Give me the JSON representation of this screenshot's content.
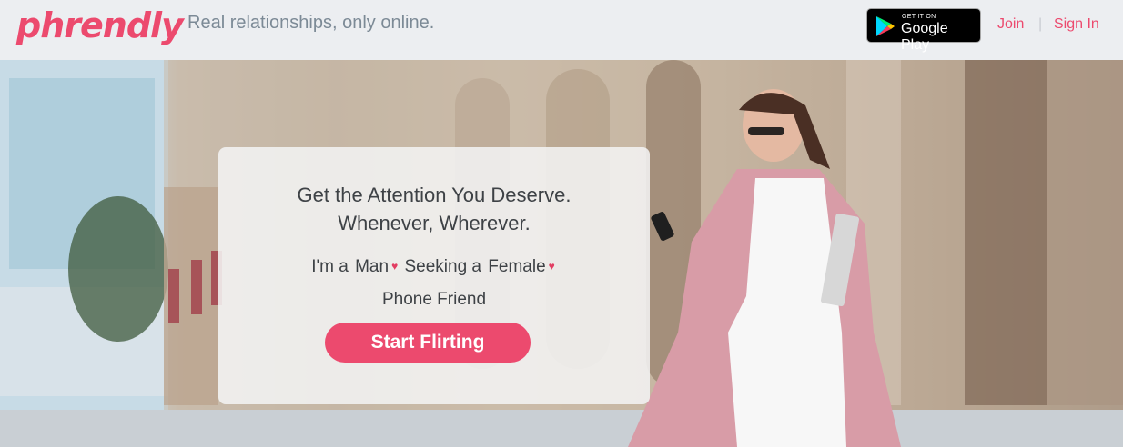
{
  "header": {
    "logo": "phrendly",
    "tagline": "Real relationships, only online.",
    "google_play": {
      "small": "GET IT ON",
      "big": "Google Play"
    },
    "nav": {
      "join": "Join",
      "separator": "|",
      "sign_in": "Sign In"
    }
  },
  "hero": {
    "headline_line1": "Get the Attention You Deserve.",
    "headline_line2": "Whenever, Wherever.",
    "im_a_label": "I'm a",
    "gender_value": "Man",
    "seeking_label": "Seeking a",
    "seeking_value": "Female",
    "relationship_value": "Phone Friend",
    "cta_label": "Start Flirting"
  },
  "colors": {
    "brand": "#ec4a6e",
    "tagline": "#7c8a96",
    "card_text": "#3e4246"
  }
}
